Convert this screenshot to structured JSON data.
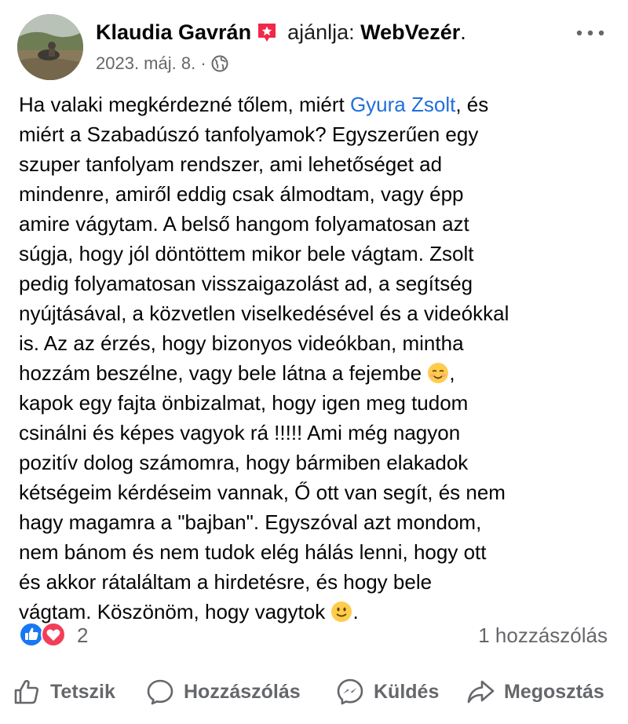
{
  "post": {
    "author": "Klaudia Gavrán",
    "verb": "ajánlja:",
    "page": "WebVezér",
    "page_suffix": ".",
    "date": "2023. máj. 8.",
    "separator": "·",
    "privacy_icon": "globe-icon",
    "more_icon": "more-dots-icon"
  },
  "body": {
    "line1_before": "Ha valaki megkérdezné tőlem, miért ",
    "line1_mention": "Gyura Zsolt",
    "line1_after": ", és",
    "lines_a": [
      "miért a Szabadúszó tanfolyamok? Egyszerűen egy",
      "szuper tanfolyam rendszer, ami lehetőséget ad",
      "mindenre, amiről eddig csak álmodtam, vagy épp",
      "amire vágytam. A belső hangom folyamatosan azt",
      "súgja, hogy jól döntöttem mikor bele vágtam. Zsolt",
      "pedig folyamatosan visszaigazolást ad, a segítség",
      "nyújtásával, a közvetlen viselkedésével és a videókkal",
      "is. Az az érzés, hogy bizonyos videókban, mintha"
    ],
    "line10_before": "hozzám beszélne, vagy bele látna a fejembe ",
    "line10_emoji": "smiling-blush-emoji",
    "line10_after": ",",
    "lines_b": [
      "kapok egy fajta önbizalmat, hogy igen meg tudom",
      "csinálni és képes vagyok rá !!!!! Ami még nagyon",
      "pozitív dolog számomra, hogy bármiben elakadok",
      "kétségeim kérdéseim vannak, Ő ott van segít, és nem",
      "hagy magamra a \"bajban\". Egyszóval azt mondom,",
      "nem bánom és nem tudok elég hálás lenni, hogy ott",
      "és akkor rátaláltam a hirdetésre, és hogy bele"
    ],
    "last_before": "vágtam. Köszönöm, hogy vagytok ",
    "last_emoji": "slight-smile-emoji",
    "last_after": "."
  },
  "stats": {
    "reaction_icons": [
      "like-icon",
      "love-icon"
    ],
    "reaction_count": "2",
    "comment_count": "1 hozzászólás"
  },
  "actions": {
    "like": "Tetszik",
    "comment": "Hozzászólás",
    "send": "Küldés",
    "share": "Megosztás"
  },
  "colors": {
    "mention": "#216fdb",
    "secondary_text": "#65676b",
    "like_blue": "#1877f2",
    "love_red": "#f33e58",
    "recommend_badge": "#f02849"
  }
}
